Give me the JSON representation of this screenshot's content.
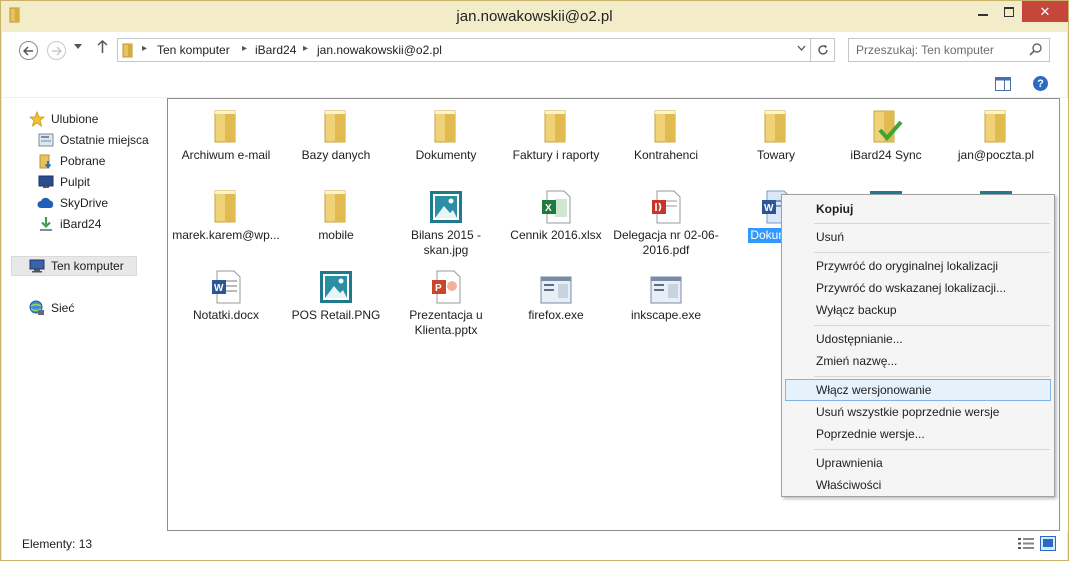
{
  "window": {
    "title": "jan.nowakowskii@o2.pl",
    "close_glyph": "✕"
  },
  "address": {
    "crumbs": [
      "Ten komputer",
      "iBard24",
      "jan.nowakowskii@o2.pl"
    ],
    "search_placeholder": "Przeszukaj: Ten komputer"
  },
  "toolbar": {
    "help_glyph": "?"
  },
  "nav": {
    "favorites_label": "Ulubione",
    "favorites": [
      {
        "label": "Ostatnie miejsca",
        "icon": "recent-places-icon"
      },
      {
        "label": "Pobrane",
        "icon": "downloads-icon"
      },
      {
        "label": "Pulpit",
        "icon": "desktop-icon"
      },
      {
        "label": "SkyDrive",
        "icon": "skydrive-icon"
      },
      {
        "label": "iBard24",
        "icon": "ibard24-icon"
      }
    ],
    "computer_label": "Ten komputer",
    "network_label": "Sieć"
  },
  "files": [
    {
      "label": "Archiwum e-mail",
      "icon": "folder-icon"
    },
    {
      "label": "Bazy danych",
      "icon": "folder-icon"
    },
    {
      "label": "Dokumenty",
      "icon": "folder-icon"
    },
    {
      "label": "Faktury i raporty",
      "icon": "folder-icon"
    },
    {
      "label": "Kontrahenci",
      "icon": "folder-icon"
    },
    {
      "label": "Towary",
      "icon": "folder-icon"
    },
    {
      "label": "iBard24 Sync",
      "icon": "synced-folder-icon"
    },
    {
      "label": "jan@poczta.pl",
      "icon": "folder-icon"
    },
    {
      "label": "marek.karem@wp...",
      "icon": "folder-icon"
    },
    {
      "label": "mobile",
      "icon": "folder-icon"
    },
    {
      "label": "Bilans 2015 - skan.jpg",
      "icon": "image-file-icon"
    },
    {
      "label": "Cennik 2016.xlsx",
      "icon": "excel-file-icon"
    },
    {
      "label": "Delegacja nr 02-06-2016.pdf",
      "icon": "pdf-file-icon"
    },
    {
      "label": "Dokumen",
      "icon": "word-file-icon"
    },
    {
      "label": "Notatki.docx",
      "icon": "word-file-icon"
    },
    {
      "label": "POS Retail.PNG",
      "icon": "image-file-icon"
    },
    {
      "label": "Prezentacja u Klienta.pptx",
      "icon": "powerpoint-file-icon"
    },
    {
      "label": "firefox.exe",
      "icon": "exe-file-icon"
    },
    {
      "label": "inkscape.exe",
      "icon": "exe-file-icon"
    }
  ],
  "context_menu": {
    "items": [
      "Kopiuj",
      "Usuń",
      "Przywróć do oryginalnej lokalizacji",
      "Przywróć do wskazanej lokalizacji...",
      "Wyłącz backup",
      "Udostępnianie...",
      "Zmień nazwę...",
      "Włącz wersjonowanie",
      "Usuń wszystkie poprzednie wersje",
      "Poprzednie wersje...",
      "Uprawnienia",
      "Właściwości"
    ],
    "hovered": "Włącz wersjonowanie"
  },
  "status": {
    "items_count": "Elementy: 13"
  },
  "colors": {
    "title_bar": "#f3ecc9",
    "close_button": "#c7463c",
    "selection": "#3399ff",
    "menu_hover": "#e5f1fb"
  }
}
